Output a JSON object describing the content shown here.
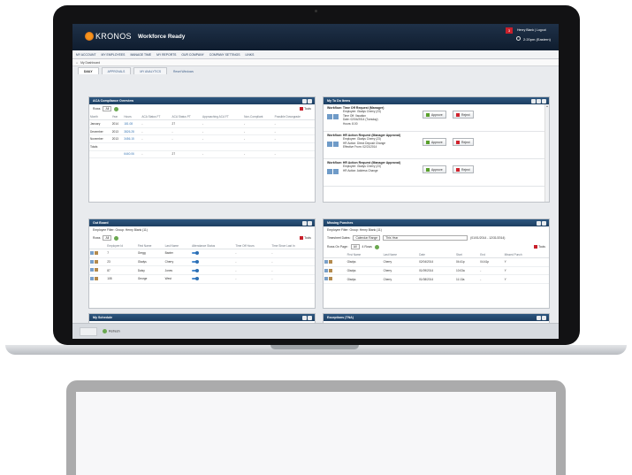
{
  "header": {
    "brand": "KRONOS",
    "product": "Workforce Ready",
    "alert_count": "3",
    "user_links": "Henry Blank  |  Logout",
    "time": "2:20pm (Eastern)"
  },
  "nav": {
    "items": [
      "MY ACCOUNT",
      "MY EMPLOYEES",
      "MANAGE TIME",
      "MY REPORTS",
      "OUR COMPANY",
      "COMPANY SETTINGS",
      "LINKS"
    ],
    "breadcrumb": "My Dashboard"
  },
  "tabs": {
    "items": [
      "DAILY",
      "APPROVALS",
      "MY ANALYTICS"
    ],
    "reset_link": "Reset Windows"
  },
  "aca": {
    "title": "ACA Compliance Overview",
    "rows_label": "Rows",
    "rows_value": "All",
    "tools_label": "Tools",
    "columns": [
      "Month",
      "Year",
      "Hours",
      "ACA Status FT",
      "ACA Status PT",
      "Approaching ACA FT",
      "Non-Compliant",
      "Possible Downgrade"
    ],
    "rows": [
      [
        "January",
        "2014",
        "181.08",
        "-",
        "27",
        "-",
        "-",
        "-"
      ],
      [
        "December",
        "2013",
        "3826.28",
        "-",
        "-",
        "-",
        "-",
        "-"
      ],
      [
        "November",
        "2013",
        "3456.15",
        "-",
        "-",
        "-",
        "-",
        "-"
      ],
      [
        "Totals",
        "",
        "",
        "",
        "",
        "",
        "",
        ""
      ],
      [
        "",
        "",
        "6440.06",
        "-",
        "27",
        "-",
        "-",
        "-"
      ]
    ]
  },
  "todo": {
    "title": "My To Do Items",
    "items": [
      {
        "heading": "Workflow: Time Off Request (Manager)",
        "lines": [
          "Employee: Gladys Cherry (23)",
          "Time Off: Vacation",
          "Date: 02/04/2014 (Tuesday)",
          "Hours: 8.00"
        ],
        "approve": "Approve",
        "reject": "Reject"
      },
      {
        "heading": "Workflow: HR Action Request (Manager Approval)",
        "lines": [
          "Employee: Gladys Cherry (23)",
          "HR Action: Direct Deposit Change",
          "Effective From: 02/21/2014"
        ],
        "approve": "Approve",
        "reject": "Reject"
      },
      {
        "heading": "Workflow: HR Action Request (Manager Approval)",
        "lines": [
          "Employee: Gladys Cherry (23)",
          "HR Action: Address Change"
        ],
        "approve": "Approve",
        "reject": "Reject"
      }
    ]
  },
  "outboard": {
    "title": "Out Board",
    "filter": "Employee Filter: Group: Henry Blank (11)",
    "rows_label": "Rows",
    "rows_value": "All",
    "tools_label": "Tools",
    "columns": [
      "Employee Id",
      "First Name",
      "Last Name",
      "Attendance Status",
      "Time Off Hours",
      "Time Since Last In"
    ],
    "rows": [
      [
        "7",
        "Gregg",
        "Baxter",
        "-",
        "-"
      ],
      [
        "23",
        "Gladys",
        "Cherry",
        "-",
        "-"
      ],
      [
        "87",
        "Daisy",
        "Jones",
        "-",
        "-"
      ],
      [
        "108",
        "George",
        "West",
        "-",
        "-"
      ]
    ]
  },
  "missing": {
    "title": "Missing Punches",
    "filter": "Employee Filter: Group: Henry Blank (11)",
    "timesheet_label": "Timesheet Dates:",
    "timesheet_range": "Calendar Range",
    "timesheet_value": "This Year",
    "date_span": "(01/01/2014 - 12/31/2014)",
    "rows_label": "Rows On Page:",
    "rows_value": "All",
    "rows_count": "4 Rows",
    "tools_label": "Tools",
    "columns": [
      "First Name",
      "Last Name",
      "Date",
      "Start",
      "End",
      "Missed Punch"
    ],
    "rows": [
      [
        "Gladys",
        "Cherry",
        "02/04/2014",
        "04:41p",
        "04:41p",
        "Y"
      ],
      [
        "Gladys",
        "Cherry",
        "01/09/2014",
        "10:03a",
        "-",
        "Y"
      ],
      [
        "Gladys",
        "Cherry",
        "01/08/2014",
        "11:13a",
        "-",
        "Y"
      ]
    ]
  },
  "schedule": {
    "title": "My Schedule"
  },
  "exceptions": {
    "title": "Exceptions (TNA)"
  },
  "footer": {
    "refresh_label": "Refresh"
  }
}
